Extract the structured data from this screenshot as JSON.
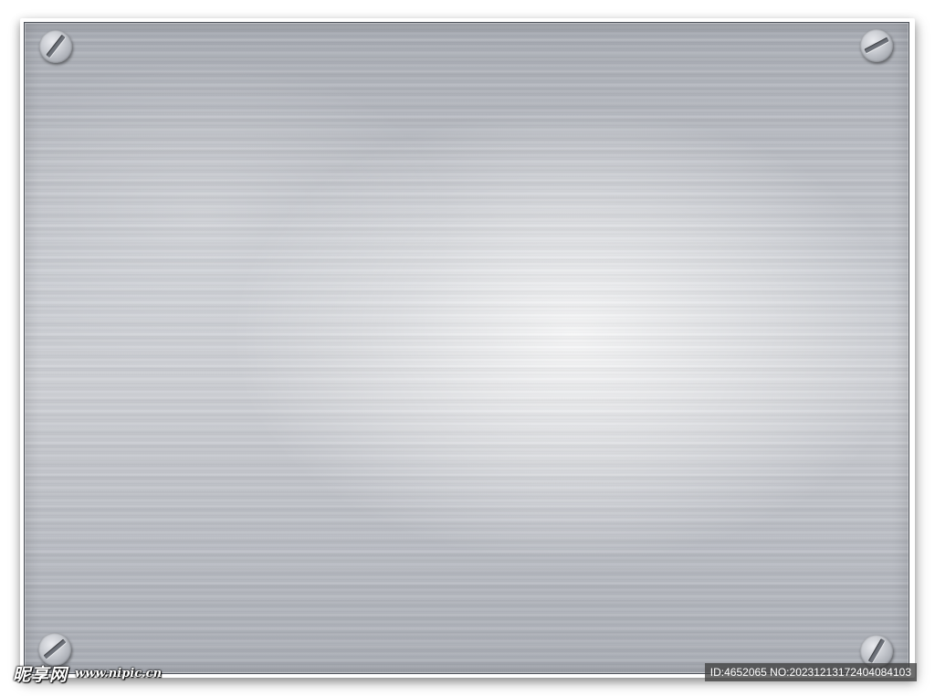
{
  "image": {
    "subject": "brushed-metal-plate",
    "plate_color": "#c9ccd2",
    "border_color": "#4a4f57",
    "screws": [
      "screw-top-left",
      "screw-top-right",
      "screw-bottom-left",
      "screw-bottom-right"
    ]
  },
  "watermark": {
    "brand": "昵享网",
    "url": "www.nipic.cn",
    "id_text": "ID:4652065 NO:20231213172404084103"
  }
}
